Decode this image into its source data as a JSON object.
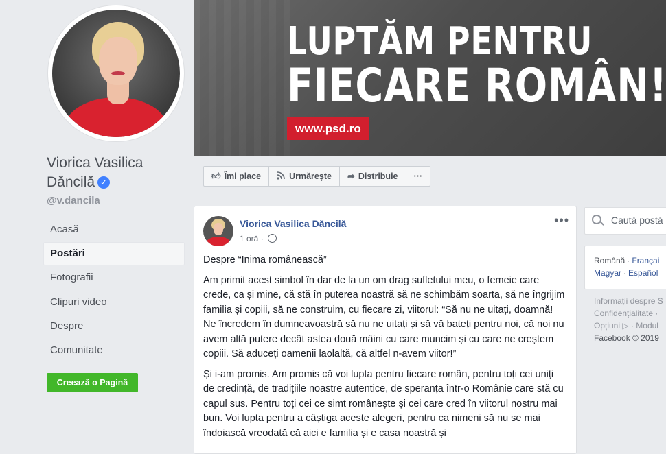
{
  "profile": {
    "name": "Viorica Vasilica Dăncilă",
    "verified_icon": "verified-badge-icon",
    "handle": "@v.dancila"
  },
  "nav": {
    "items": [
      {
        "label": "Acasă",
        "active": false
      },
      {
        "label": "Postări",
        "active": true
      },
      {
        "label": "Fotografii",
        "active": false
      },
      {
        "label": "Clipuri video",
        "active": false
      },
      {
        "label": "Despre",
        "active": false
      },
      {
        "label": "Comunitate",
        "active": false
      }
    ]
  },
  "create_page_label": "Creează o Pagină",
  "cover": {
    "line1": "LUPTĂM PENTRU",
    "line2": "FIECARE ROMÂN!",
    "url": "www.psd.ro"
  },
  "actions": {
    "like": "Îmi place",
    "follow": "Urmărește",
    "share": "Distribuie",
    "more": "···"
  },
  "post": {
    "author": "Viorica Vasilica Dăncilă",
    "time": "1 oră",
    "separator": "·",
    "more": "•••",
    "paragraphs": [
      "Despre “Inima românească”",
      "Am primit acest simbol în dar de la un om drag sufletului meu, o femeie care crede, ca și mine, că stă în puterea noastră să ne schimbăm soarta, să ne îngrijim familia și copiii, să ne construim, cu fiecare zi, viitorul: “Să nu ne uitați, doamnă! Ne încredem în dumneavoastră să nu ne uitați și să vă bateți pentru noi, că noi nu avem altă putere decât astea două mâini cu care muncim și cu care ne creștem copiii. Să aduceți oamenii laolaltă, că altfel n-avem viitor!”",
      "Și i-am promis. Am promis că voi lupta pentru fiecare român, pentru toți cei uniți de credință, de tradițiile noastre autentice, de speranța într-o Românie care stă cu capul sus. Pentru toți cei ce simt românește și cei care cred în viitorul nostru mai bun. Voi lupta pentru a câștiga aceste alegeri, pentru ca nimeni să nu se mai îndoiască vreodată că aici e familia și e casa noastră și"
    ]
  },
  "search": {
    "placeholder": "Caută postă"
  },
  "languages": {
    "row1": [
      "Română",
      "Françai"
    ],
    "row2": [
      "Magyar",
      "Español"
    ]
  },
  "footer": {
    "line1": "Informații despre S",
    "line2": "Confidențialitate ·",
    "line3_a": "Opțiuni",
    "line3_b": "Modul",
    "line4": "Facebook © 2019"
  },
  "colors": {
    "accent": "#385898",
    "brand_red": "#d21f2e",
    "create_green": "#42b72a"
  }
}
